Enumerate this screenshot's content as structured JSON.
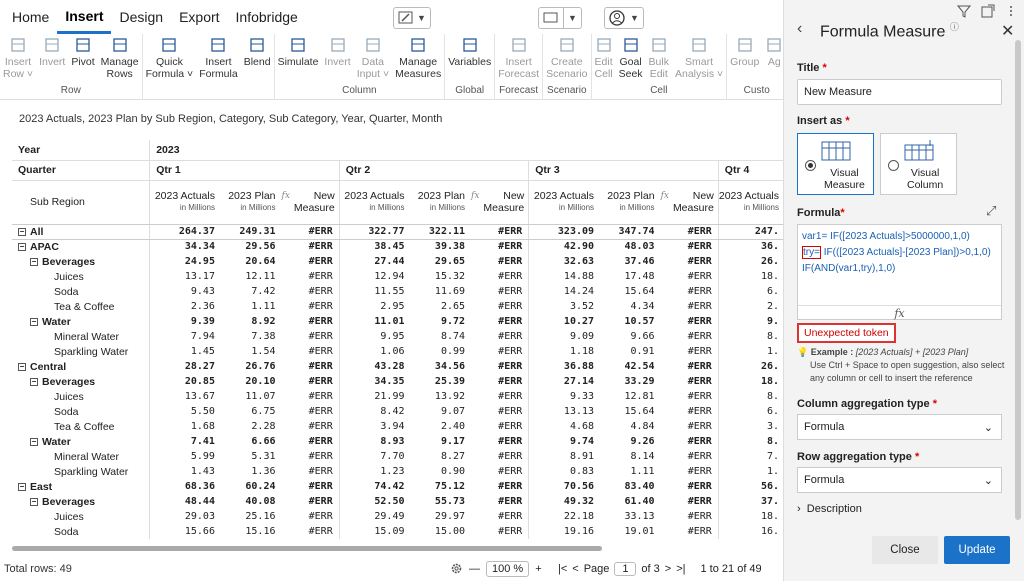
{
  "menu": [
    "Home",
    "Insert",
    "Design",
    "Export",
    "Infobridge"
  ],
  "ribbon": [
    {
      "name": "Row",
      "buttons": [
        {
          "label": "Insert\nRow",
          "icon": "insert-row-icon",
          "dis": true,
          "caret": true
        },
        {
          "label": "Invert",
          "icon": "invert-icon",
          "dis": true
        },
        {
          "label": "Pivot",
          "icon": "pivot-icon",
          "dis": false
        },
        {
          "label": "Manage\nRows",
          "icon": "manage-rows-icon",
          "dis": false
        }
      ]
    },
    {
      "name": "",
      "buttons": [
        {
          "label": "Quick\nFormula",
          "icon": "lightning-icon",
          "dis": false,
          "caret": true
        },
        {
          "label": "Insert\nFormula",
          "icon": "insert-formula-icon",
          "dis": false
        },
        {
          "label": "Blend",
          "icon": "blend-icon",
          "dis": false
        }
      ]
    },
    {
      "name": "Column",
      "buttons": [
        {
          "label": "Simulate",
          "icon": "simulate-icon",
          "dis": false
        },
        {
          "label": "Invert",
          "icon": "invert-icon",
          "dis": true
        },
        {
          "label": "Data\nInput",
          "icon": "data-input-icon",
          "dis": true,
          "caret": true
        },
        {
          "label": "Manage\nMeasures",
          "icon": "manage-measures-icon",
          "dis": false
        }
      ]
    },
    {
      "name": "Global",
      "buttons": [
        {
          "label": "Variables",
          "icon": "variables-icon",
          "dis": false
        }
      ]
    },
    {
      "name": "Forecast",
      "buttons": [
        {
          "label": "Insert\nForecast",
          "icon": "forecast-icon",
          "dis": true
        }
      ]
    },
    {
      "name": "Scenario",
      "buttons": [
        {
          "label": "Create\nScenario",
          "icon": "scenario-icon",
          "dis": true
        }
      ]
    },
    {
      "name": "Cell",
      "buttons": [
        {
          "label": "Edit\nCell",
          "icon": "edit-cell-icon",
          "dis": true
        },
        {
          "label": "Goal\nSeek",
          "icon": "goal-seek-icon",
          "dis": false
        },
        {
          "label": "Bulk\nEdit",
          "icon": "bulk-edit-icon",
          "dis": true
        },
        {
          "label": "Smart\nAnalysis",
          "icon": "smart-analysis-icon",
          "dis": true,
          "caret": true
        }
      ]
    },
    {
      "name": "Custo",
      "buttons": [
        {
          "label": "Group",
          "icon": "group-icon",
          "dis": true
        },
        {
          "label": "Ag",
          "icon": "agg-icon",
          "dis": true
        }
      ]
    }
  ],
  "report": {
    "subtitle": "2023 Actuals, 2023 Plan by Sub Region, Category, Sub Category, Year, Quarter, Month",
    "year_label": "Year",
    "year_value": "2023",
    "quarter_label": "Quarter",
    "quarters": [
      "Qtr 1",
      "Qtr 2",
      "Qtr 3",
      "Qtr 4"
    ],
    "sub_region_label": "Sub Region",
    "col_headers": [
      {
        "t": "2023 Actuals",
        "s": "in Millions"
      },
      {
        "t": "2023 Plan",
        "s": "in Millions"
      },
      {
        "t": "New\nMeasure",
        "s": ""
      }
    ],
    "rows": [
      {
        "label": "All",
        "level": 0,
        "exp": true,
        "bold": true,
        "total": true,
        "v": [
          "264.37",
          "249.31",
          "#ERR",
          "322.77",
          "322.11",
          "#ERR",
          "323.09",
          "347.74",
          "#ERR",
          "247."
        ]
      },
      {
        "label": "APAC",
        "level": 0,
        "exp": true,
        "bold": true,
        "v": [
          "34.34",
          "29.56",
          "#ERR",
          "38.45",
          "39.38",
          "#ERR",
          "42.90",
          "48.03",
          "#ERR",
          "36."
        ]
      },
      {
        "label": "Beverages",
        "level": 1,
        "exp": true,
        "bold": true,
        "v": [
          "24.95",
          "20.64",
          "#ERR",
          "27.44",
          "29.65",
          "#ERR",
          "32.63",
          "37.46",
          "#ERR",
          "26."
        ]
      },
      {
        "label": "Juices",
        "level": 2,
        "v": [
          "13.17",
          "12.11",
          "#ERR",
          "12.94",
          "15.32",
          "#ERR",
          "14.88",
          "17.48",
          "#ERR",
          "18."
        ]
      },
      {
        "label": "Soda",
        "level": 2,
        "v": [
          "9.43",
          "7.42",
          "#ERR",
          "11.55",
          "11.69",
          "#ERR",
          "14.24",
          "15.64",
          "#ERR",
          "6."
        ]
      },
      {
        "label": "Tea & Coffee",
        "level": 2,
        "v": [
          "2.36",
          "1.11",
          "#ERR",
          "2.95",
          "2.65",
          "#ERR",
          "3.52",
          "4.34",
          "#ERR",
          "2."
        ]
      },
      {
        "label": "Water",
        "level": 1,
        "exp": true,
        "bold": true,
        "v": [
          "9.39",
          "8.92",
          "#ERR",
          "11.01",
          "9.72",
          "#ERR",
          "10.27",
          "10.57",
          "#ERR",
          "9."
        ]
      },
      {
        "label": "Mineral Water",
        "level": 2,
        "v": [
          "7.94",
          "7.38",
          "#ERR",
          "9.95",
          "8.74",
          "#ERR",
          "9.09",
          "9.66",
          "#ERR",
          "8."
        ]
      },
      {
        "label": "Sparkling Water",
        "level": 2,
        "v": [
          "1.45",
          "1.54",
          "#ERR",
          "1.06",
          "0.99",
          "#ERR",
          "1.18",
          "0.91",
          "#ERR",
          "1."
        ]
      },
      {
        "label": "Central",
        "level": 0,
        "exp": true,
        "bold": true,
        "v": [
          "28.27",
          "26.76",
          "#ERR",
          "43.28",
          "34.56",
          "#ERR",
          "36.88",
          "42.54",
          "#ERR",
          "26."
        ]
      },
      {
        "label": "Beverages",
        "level": 1,
        "exp": true,
        "bold": true,
        "v": [
          "20.85",
          "20.10",
          "#ERR",
          "34.35",
          "25.39",
          "#ERR",
          "27.14",
          "33.29",
          "#ERR",
          "18."
        ]
      },
      {
        "label": "Juices",
        "level": 2,
        "v": [
          "13.67",
          "11.07",
          "#ERR",
          "21.99",
          "13.92",
          "#ERR",
          "9.33",
          "12.81",
          "#ERR",
          "8."
        ]
      },
      {
        "label": "Soda",
        "level": 2,
        "v": [
          "5.50",
          "6.75",
          "#ERR",
          "8.42",
          "9.07",
          "#ERR",
          "13.13",
          "15.64",
          "#ERR",
          "6."
        ]
      },
      {
        "label": "Tea & Coffee",
        "level": 2,
        "v": [
          "1.68",
          "2.28",
          "#ERR",
          "3.94",
          "2.40",
          "#ERR",
          "4.68",
          "4.84",
          "#ERR",
          "3."
        ]
      },
      {
        "label": "Water",
        "level": 1,
        "exp": true,
        "bold": true,
        "v": [
          "7.41",
          "6.66",
          "#ERR",
          "8.93",
          "9.17",
          "#ERR",
          "9.74",
          "9.26",
          "#ERR",
          "8."
        ]
      },
      {
        "label": "Mineral Water",
        "level": 2,
        "v": [
          "5.99",
          "5.31",
          "#ERR",
          "7.70",
          "8.27",
          "#ERR",
          "8.91",
          "8.14",
          "#ERR",
          "7."
        ]
      },
      {
        "label": "Sparkling Water",
        "level": 2,
        "v": [
          "1.43",
          "1.36",
          "#ERR",
          "1.23",
          "0.90",
          "#ERR",
          "0.83",
          "1.11",
          "#ERR",
          "1."
        ]
      },
      {
        "label": "East",
        "level": 0,
        "exp": true,
        "bold": true,
        "v": [
          "68.36",
          "60.24",
          "#ERR",
          "74.42",
          "75.12",
          "#ERR",
          "70.56",
          "83.40",
          "#ERR",
          "56."
        ]
      },
      {
        "label": "Beverages",
        "level": 1,
        "exp": true,
        "bold": true,
        "v": [
          "48.44",
          "40.08",
          "#ERR",
          "52.50",
          "55.73",
          "#ERR",
          "49.32",
          "61.40",
          "#ERR",
          "37."
        ]
      },
      {
        "label": "Juices",
        "level": 2,
        "v": [
          "29.03",
          "25.16",
          "#ERR",
          "29.49",
          "29.97",
          "#ERR",
          "22.18",
          "33.13",
          "#ERR",
          "18."
        ]
      },
      {
        "label": "Soda",
        "level": 2,
        "v": [
          "15.66",
          "15.16",
          "#ERR",
          "15.09",
          "15.00",
          "#ERR",
          "19.16",
          "19.01",
          "#ERR",
          "16."
        ]
      }
    ]
  },
  "status": {
    "total_rows": "Total rows: 49",
    "zoom": "100 %",
    "page_label": "Page",
    "page": "1",
    "of_pages": "of 3",
    "range": "1 to 21 of 49"
  },
  "panel": {
    "title": "Formula Measure",
    "title_label": "Title",
    "title_value": "New Measure",
    "insert_as_label": "Insert as",
    "opt_measure": "Visual\nMeasure",
    "opt_column": "Visual\nColumn",
    "formula_label": "Formula",
    "formula_lines": [
      "var1= IF([2023 Actuals]>5000000,1,0)",
      "try= IF(([2023 Actuals]-[2023 Plan])>0,1,0)",
      "IF(AND(var1,try),1,0)"
    ],
    "error": "Unexpected token",
    "example_label": "Example :",
    "example_value": "[2023 Actuals] + [2023 Plan]",
    "help_text": "Use Ctrl + Space to open suggestion, also select any column or cell to insert the reference",
    "col_agg_label": "Column aggregation type",
    "col_agg_value": "Formula",
    "row_agg_label": "Row aggregation type",
    "row_agg_value": "Formula",
    "description_label": "Description",
    "close": "Close",
    "update": "Update"
  },
  "colors": {
    "accent": "#1a73c9",
    "error": "#d33333",
    "formula_text": "#1a5fb4"
  }
}
